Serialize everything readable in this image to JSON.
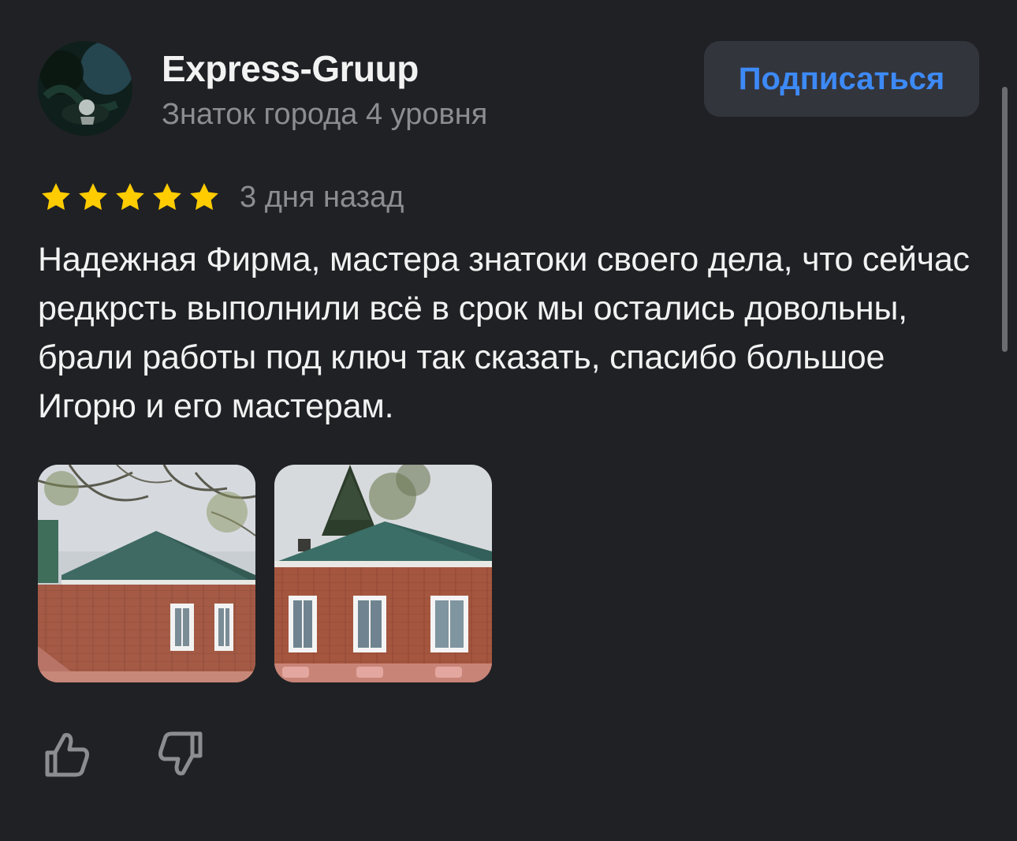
{
  "author": {
    "name": "Express-Gruup",
    "level": "Знаток города 4 уровня",
    "avatar_icon": "avatar-photo"
  },
  "subscribe_label": "Подписаться",
  "review": {
    "rating": 5,
    "rating_max": 5,
    "date": "3 дня назад",
    "text": "Надежная Фирма, мастера знатоки своего дела, что сейчас редкрсть выполнили всё в срок мы остались довольны, брали работы под ключ так сказать, спасибо большое Игорю и его мастерам."
  },
  "photos": [
    {
      "icon": "house-photo"
    },
    {
      "icon": "house-photo"
    }
  ],
  "reactions": {
    "like_icon": "thumbs-up-icon",
    "dislike_icon": "thumbs-down-icon"
  },
  "colors": {
    "background": "#202125",
    "accent": "#3d8af7",
    "star": "#ffcc00",
    "secondary_text": "#8c8d91",
    "button_bg": "#33353d"
  }
}
